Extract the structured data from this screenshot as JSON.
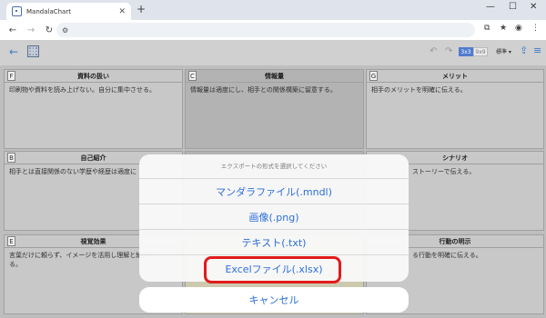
{
  "browser": {
    "tab_title": "MandalaChart",
    "tab_close": "✕",
    "new_tab": "+",
    "win_min": "—",
    "win_max": "☐",
    "win_close": "✕"
  },
  "apptoolbar": {
    "grid_3x3": "3x3",
    "grid_9x9": "9x9",
    "layout_select": "標準 ▾"
  },
  "cells": {
    "F": {
      "letter": "F",
      "title": "資料の扱い",
      "text": "印刷物や資料を読み上げない。自分に集中させる。"
    },
    "C": {
      "letter": "C",
      "title": "情報量",
      "text": "情報量は適度にし、相手との関係構築に留意する。"
    },
    "G": {
      "letter": "G",
      "title": "メリット",
      "text": "相手のメリットを明確に伝える。"
    },
    "B": {
      "letter": "B",
      "title": "自己紹介",
      "text": "相手とは直接関係のない学歴や経歴は適度に"
    },
    "H": {
      "title": "シナリオ",
      "text": "ストーリーで伝える。"
    },
    "E": {
      "letter": "E",
      "title": "視覚効果",
      "text": "言葉だけに頼らず、イメージを活用し理解と納得を\nる。"
    },
    "I": {
      "title": "行動の明示",
      "text": "る行動を明確に伝える。"
    }
  },
  "export_sheet": {
    "title": "エクスポートの形式を選択してください",
    "options": [
      "マンダラファイル(.mndl)",
      "画像(.png)",
      "テキスト(.txt)",
      "Excelファイル(.xlsx)"
    ],
    "cancel": "キャンセル"
  }
}
